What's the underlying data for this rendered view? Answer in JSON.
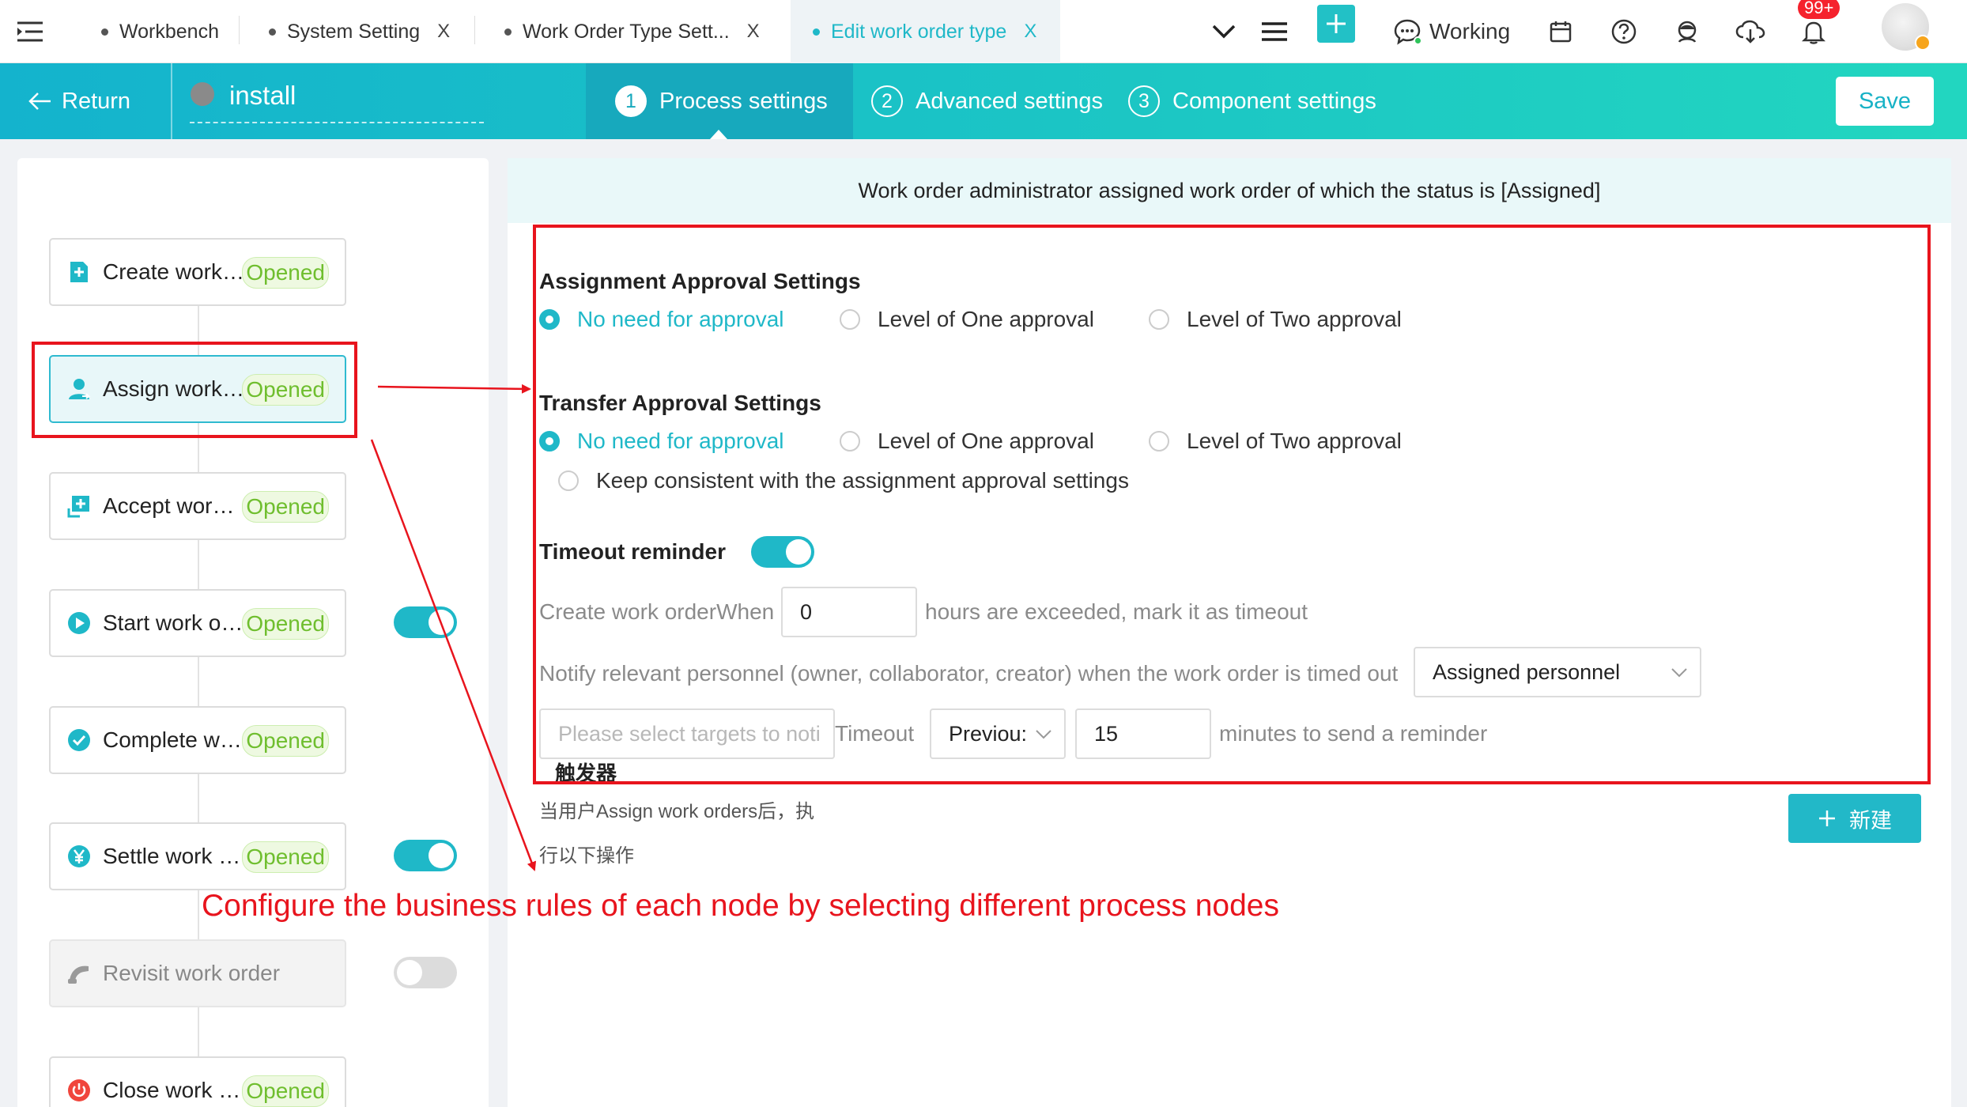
{
  "tabs": [
    {
      "label": "Workbench",
      "closable": false,
      "active": false
    },
    {
      "label": "System Setting",
      "closable": true,
      "active": false
    },
    {
      "label": "Work Order Type Sett...",
      "closable": true,
      "active": false
    },
    {
      "label": "Edit work order type",
      "closable": true,
      "active": true
    }
  ],
  "tab_close_symbol": "X",
  "toolbar": {
    "working_label": "Working",
    "notification_badge": "99+",
    "icons": [
      "menu-toggle-icon",
      "chevron-down-icon",
      "hamburger-icon",
      "plus-icon",
      "chat-icon",
      "calendar-icon",
      "help-icon",
      "user-service-icon",
      "cloud-download-icon",
      "bell-icon",
      "avatar"
    ]
  },
  "header": {
    "return_label": "Return",
    "install_name": "install",
    "steps": [
      {
        "num": "1",
        "label": "Process settings",
        "active": true
      },
      {
        "num": "2",
        "label": "Advanced settings",
        "active": false
      },
      {
        "num": "3",
        "label": "Component settings",
        "active": false
      }
    ],
    "save_label": "Save"
  },
  "nodes": [
    {
      "label": "Create work order",
      "badge": "Opened",
      "icon": "create-icon",
      "switch": null,
      "state": "normal"
    },
    {
      "label": "Assign work order",
      "badge": "Opened",
      "icon": "assign-user-icon",
      "switch": null,
      "state": "active"
    },
    {
      "label": "Accept work order",
      "badge": "Opened",
      "icon": "accept-icon",
      "switch": null,
      "state": "normal"
    },
    {
      "label": "Start work order",
      "badge": "Opened",
      "icon": "play-icon",
      "switch": "on",
      "state": "normal"
    },
    {
      "label": "Complete work order",
      "badge": "Opened",
      "icon": "check-circle-icon",
      "switch": null,
      "state": "normal"
    },
    {
      "label": "Settle work order",
      "badge": "Opened",
      "icon": "yen-icon",
      "switch": "on",
      "state": "normal"
    },
    {
      "label": "Revisit work order",
      "badge": "",
      "icon": "phone-icon",
      "switch": "off",
      "state": "disabled"
    },
    {
      "label": "Close work order",
      "badge": "Opened",
      "icon": "power-icon",
      "switch": null,
      "state": "normal"
    }
  ],
  "banner_text": "Work order administrator assigned work order of which the status is [Assigned]",
  "assignment": {
    "title": "Assignment Approval Settings",
    "options": [
      "No need for approval",
      "Level of One approval",
      "Level of Two approval"
    ],
    "selected": 0
  },
  "transfer": {
    "title": "Transfer Approval Settings",
    "options": [
      "No need for approval",
      "Level of One approval",
      "Level of Two approval",
      "Keep consistent with the assignment approval settings"
    ],
    "selected": 0
  },
  "timeout": {
    "title": "Timeout reminder",
    "enabled": true,
    "create_prefix": "Create work orderWhen",
    "hours_value": "0",
    "hours_suffix": "hours are exceeded, mark it as timeout",
    "notify_text": "Notify relevant personnel (owner, collaborator, creator) when the work order is timed out",
    "notify_select": "Assigned personnel",
    "targets_placeholder": "Please select targets to noti",
    "timeout_label": "Timeout",
    "when_select": "Previou:",
    "minutes_value": "15",
    "minutes_suffix": "minutes to send a reminder"
  },
  "trigger": {
    "title": "触发器",
    "desc_line1": "当用户Assign work orders后，执",
    "desc_line2": "行以下操作",
    "new_button": "新建"
  },
  "annotation_text": "Configure the business rules of each node by selecting different process nodes",
  "colors": {
    "accent": "#1fb8c8",
    "badge_green": "#6fbe2e",
    "annotation_red": "#e8141d"
  }
}
